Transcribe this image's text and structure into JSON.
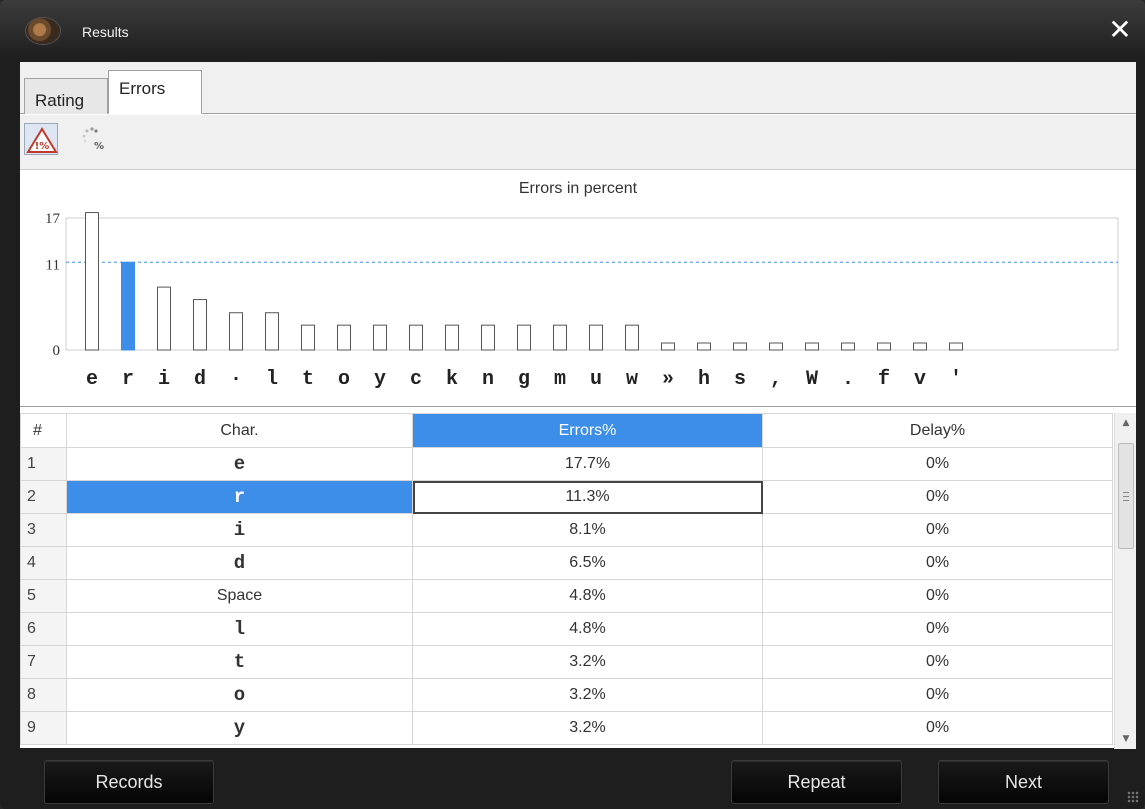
{
  "window": {
    "title": "Results",
    "close_label": "✕"
  },
  "tabs": [
    {
      "label": "Rating",
      "active": false
    },
    {
      "label": "Errors",
      "active": true
    }
  ],
  "toolbar": {
    "errors_percent_icon_text": "!%",
    "delay_percent_icon_text": "%"
  },
  "chart_data": {
    "type": "bar",
    "title": "Errors in percent",
    "categories": [
      "e",
      "r",
      "i",
      "d",
      "·",
      "l",
      "t",
      "o",
      "y",
      "c",
      "k",
      "n",
      "g",
      "m",
      "u",
      "w",
      "»",
      "h",
      "s",
      ",",
      "W",
      ".",
      "f",
      "v",
      "'"
    ],
    "values": [
      17.7,
      11.3,
      8.1,
      6.5,
      4.8,
      4.8,
      3.2,
      3.2,
      3.2,
      3.2,
      3.2,
      3.2,
      3.2,
      3.2,
      3.2,
      3.2,
      0.9,
      0.9,
      0.9,
      0.9,
      0.9,
      0.9,
      0.9,
      0.9,
      0.9
    ],
    "highlighted_index": 1,
    "yticks": [
      0,
      11,
      17
    ],
    "ylim": [
      0,
      17
    ],
    "reference_line": 11.3,
    "grid": false,
    "colors": {
      "bar_fill": "#ffffff",
      "bar_stroke": "#555555",
      "highlight": "#3d8ee8",
      "reference_line": "#3d8ee8"
    }
  },
  "table": {
    "headers": [
      "#",
      "Char.",
      "Errors%",
      "Delay%"
    ],
    "sorted_column": "Errors%",
    "rows": [
      {
        "n": "1",
        "char": "e",
        "errors": "17.7%",
        "delay": "0%"
      },
      {
        "n": "2",
        "char": "r",
        "errors": "11.3%",
        "delay": "0%"
      },
      {
        "n": "3",
        "char": "i",
        "errors": "8.1%",
        "delay": "0%"
      },
      {
        "n": "4",
        "char": "d",
        "errors": "6.5%",
        "delay": "0%"
      },
      {
        "n": "5",
        "char": "Space",
        "errors": "4.8%",
        "delay": "0%"
      },
      {
        "n": "6",
        "char": "l",
        "errors": "4.8%",
        "delay": "0%"
      },
      {
        "n": "7",
        "char": "t",
        "errors": "3.2%",
        "delay": "0%"
      },
      {
        "n": "8",
        "char": "o",
        "errors": "3.2%",
        "delay": "0%"
      },
      {
        "n": "9",
        "char": "y",
        "errors": "3.2%",
        "delay": "0%"
      }
    ],
    "selected_row": 2
  },
  "buttons": {
    "records": "Records",
    "repeat": "Repeat",
    "next": "Next"
  },
  "colors": {
    "accent": "#3d8ee8",
    "window_frame": "#1e1e1e"
  }
}
